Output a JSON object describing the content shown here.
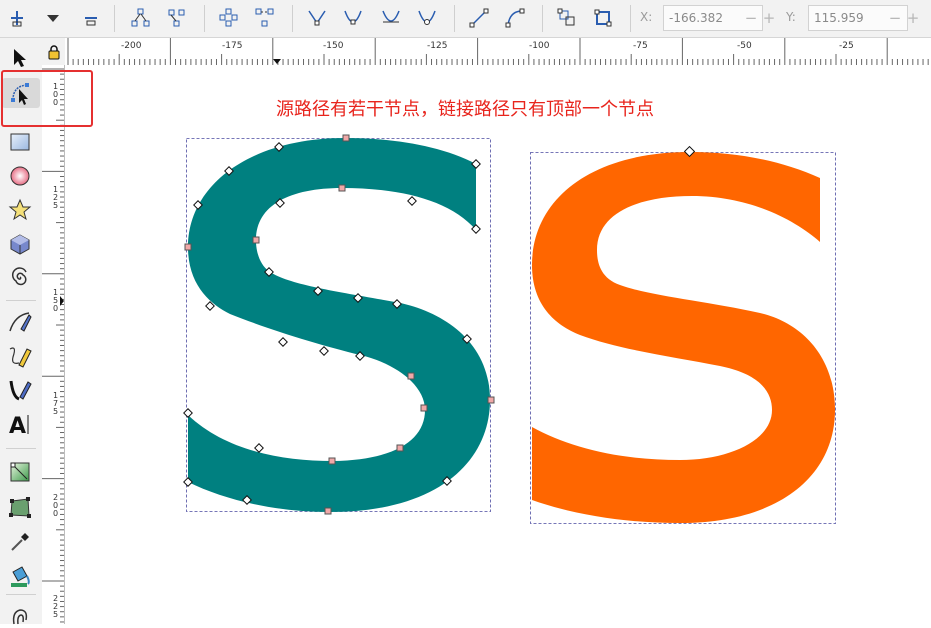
{
  "toolbar": {
    "x_label": "X:",
    "x_value": "-166.382",
    "y_label": "Y:",
    "y_value": "115.959",
    "spin_minus": "−",
    "spin_plus": "+",
    "buttons": [
      "insert-node",
      "insert-menu",
      "delete-node",
      "join-nodes",
      "break-path",
      "join-segment",
      "delete-segment",
      "cusp-node",
      "smooth-node",
      "symmetric-node",
      "auto-smooth-node",
      "line-segment",
      "curve-segment",
      "object-to-path",
      "stroke-to-path"
    ]
  },
  "rulers": {
    "horizontal": [
      "-200",
      "-175",
      "-150",
      "-125",
      "-100",
      "-75",
      "-50",
      "-25"
    ],
    "vertical": [
      [
        "1",
        "0",
        "0"
      ],
      [
        "1",
        "2",
        "5"
      ],
      [
        "1",
        "5",
        "0"
      ],
      [
        "1",
        "7",
        "5"
      ],
      [
        "2",
        "0",
        "0"
      ],
      [
        "2",
        "2",
        "5"
      ]
    ]
  },
  "tools": [
    "selector-tool",
    "node-tool",
    "rectangle-tool",
    "ellipse-tool",
    "star-tool",
    "3d-box-tool",
    "spiral-tool",
    "pen-tool",
    "pencil-tool",
    "calligraphy-tool",
    "text-tool",
    "gradient-tool",
    "mesh-tool",
    "dropper-tool",
    "paint-bucket-tool",
    "tweak-tool"
  ],
  "canvas": {
    "annotation": "源路径有若干节点，链接路径只有顶部一个节点",
    "teal_color": "#008080",
    "orange_color": "#ff6600"
  },
  "colors": {
    "highlight": "#e53030",
    "annotation": "#e8241c"
  }
}
